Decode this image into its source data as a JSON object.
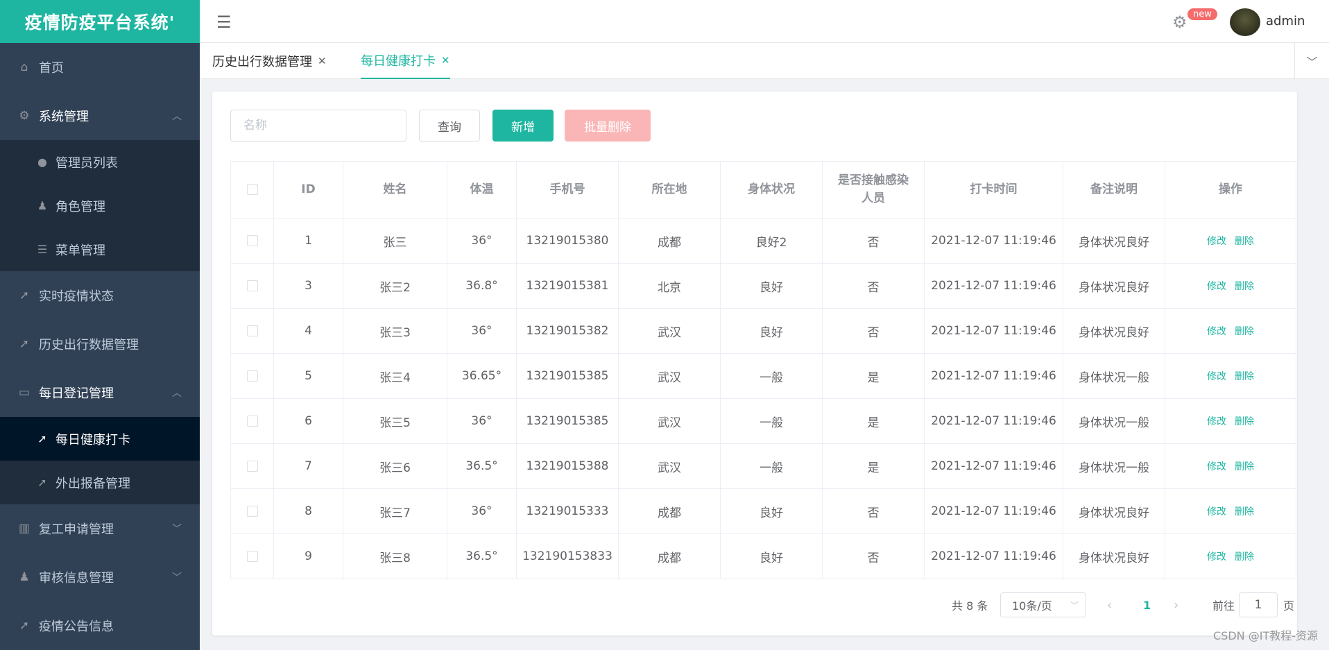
{
  "app": {
    "title": "疫情防疫平台系统'"
  },
  "sidebar": {
    "items": [
      {
        "label": "首页",
        "icon": "home-icon"
      },
      {
        "label": "系统管理",
        "icon": "gear-icon",
        "expanded": true,
        "children": [
          {
            "label": "管理员列表",
            "icon": "user-icon"
          },
          {
            "label": "角色管理",
            "icon": "role-icon"
          },
          {
            "label": "菜单管理",
            "icon": "list-icon"
          }
        ]
      },
      {
        "label": "实时疫情状态",
        "icon": "send-icon"
      },
      {
        "label": "历史出行数据管理",
        "icon": "send-icon"
      },
      {
        "label": "每日登记管理",
        "icon": "message-icon",
        "expanded": true,
        "children": [
          {
            "label": "每日健康打卡",
            "icon": "send-icon",
            "active": true
          },
          {
            "label": "外出报备管理",
            "icon": "send-icon"
          }
        ]
      },
      {
        "label": "复工申请管理",
        "icon": "chart-icon",
        "expanded": false
      },
      {
        "label": "审核信息管理",
        "icon": "role-icon",
        "expanded": false
      },
      {
        "label": "疫情公告信息",
        "icon": "send-icon"
      }
    ]
  },
  "header": {
    "badge": "new",
    "username": "admin"
  },
  "tabs": [
    {
      "label": "历史出行数据管理",
      "active": false
    },
    {
      "label": "每日健康打卡",
      "active": true
    }
  ],
  "toolbar": {
    "search_placeholder": "名称",
    "search_value": "",
    "query_label": "查询",
    "add_label": "新增",
    "batch_delete_label": "批量删除"
  },
  "table": {
    "columns": [
      "ID",
      "姓名",
      "体温",
      "手机号",
      "所在地",
      "身体状况",
      "是否接触感染人员",
      "打卡时间",
      "备注说明",
      "操作"
    ],
    "edit_label": "修改",
    "delete_label": "删除",
    "rows": [
      {
        "id": "1",
        "name": "张三",
        "temp": "36°",
        "phone": "13219015380",
        "location": "成都",
        "condition": "良好2",
        "contact": "否",
        "time": "2021-12-07 11:19:46",
        "note": "身体状况良好"
      },
      {
        "id": "3",
        "name": "张三2",
        "temp": "36.8°",
        "phone": "13219015381",
        "location": "北京",
        "condition": "良好",
        "contact": "否",
        "time": "2021-12-07 11:19:46",
        "note": "身体状况良好"
      },
      {
        "id": "4",
        "name": "张三3",
        "temp": "36°",
        "phone": "13219015382",
        "location": "武汉",
        "condition": "良好",
        "contact": "否",
        "time": "2021-12-07 11:19:46",
        "note": "身体状况良好"
      },
      {
        "id": "5",
        "name": "张三4",
        "temp": "36.65°",
        "phone": "13219015385",
        "location": "武汉",
        "condition": "一般",
        "contact": "是",
        "time": "2021-12-07 11:19:46",
        "note": "身体状况一般"
      },
      {
        "id": "6",
        "name": "张三5",
        "temp": "36°",
        "phone": "13219015385",
        "location": "武汉",
        "condition": "一般",
        "contact": "是",
        "time": "2021-12-07 11:19:46",
        "note": "身体状况一般"
      },
      {
        "id": "7",
        "name": "张三6",
        "temp": "36.5°",
        "phone": "13219015388",
        "location": "武汉",
        "condition": "一般",
        "contact": "是",
        "time": "2021-12-07 11:19:46",
        "note": "身体状况一般"
      },
      {
        "id": "8",
        "name": "张三7",
        "temp": "36°",
        "phone": "13219015333",
        "location": "成都",
        "condition": "良好",
        "contact": "否",
        "time": "2021-12-07 11:19:46",
        "note": "身体状况良好"
      },
      {
        "id": "9",
        "name": "张三8",
        "temp": "36.5°",
        "phone": "132190153833",
        "location": "成都",
        "condition": "良好",
        "contact": "否",
        "time": "2021-12-07 11:19:46",
        "note": "身体状况良好"
      }
    ]
  },
  "pagination": {
    "total_label": "共 8 条",
    "page_size": "10条/页",
    "current_page": "1",
    "goto_prefix": "前往",
    "goto_value": "1",
    "goto_suffix": "页"
  },
  "watermark": "CSDN @IT教程-资源",
  "colors": {
    "accent": "#1eb6a1",
    "sidebar_bg": "#304156",
    "danger_light": "#fab6b6"
  }
}
